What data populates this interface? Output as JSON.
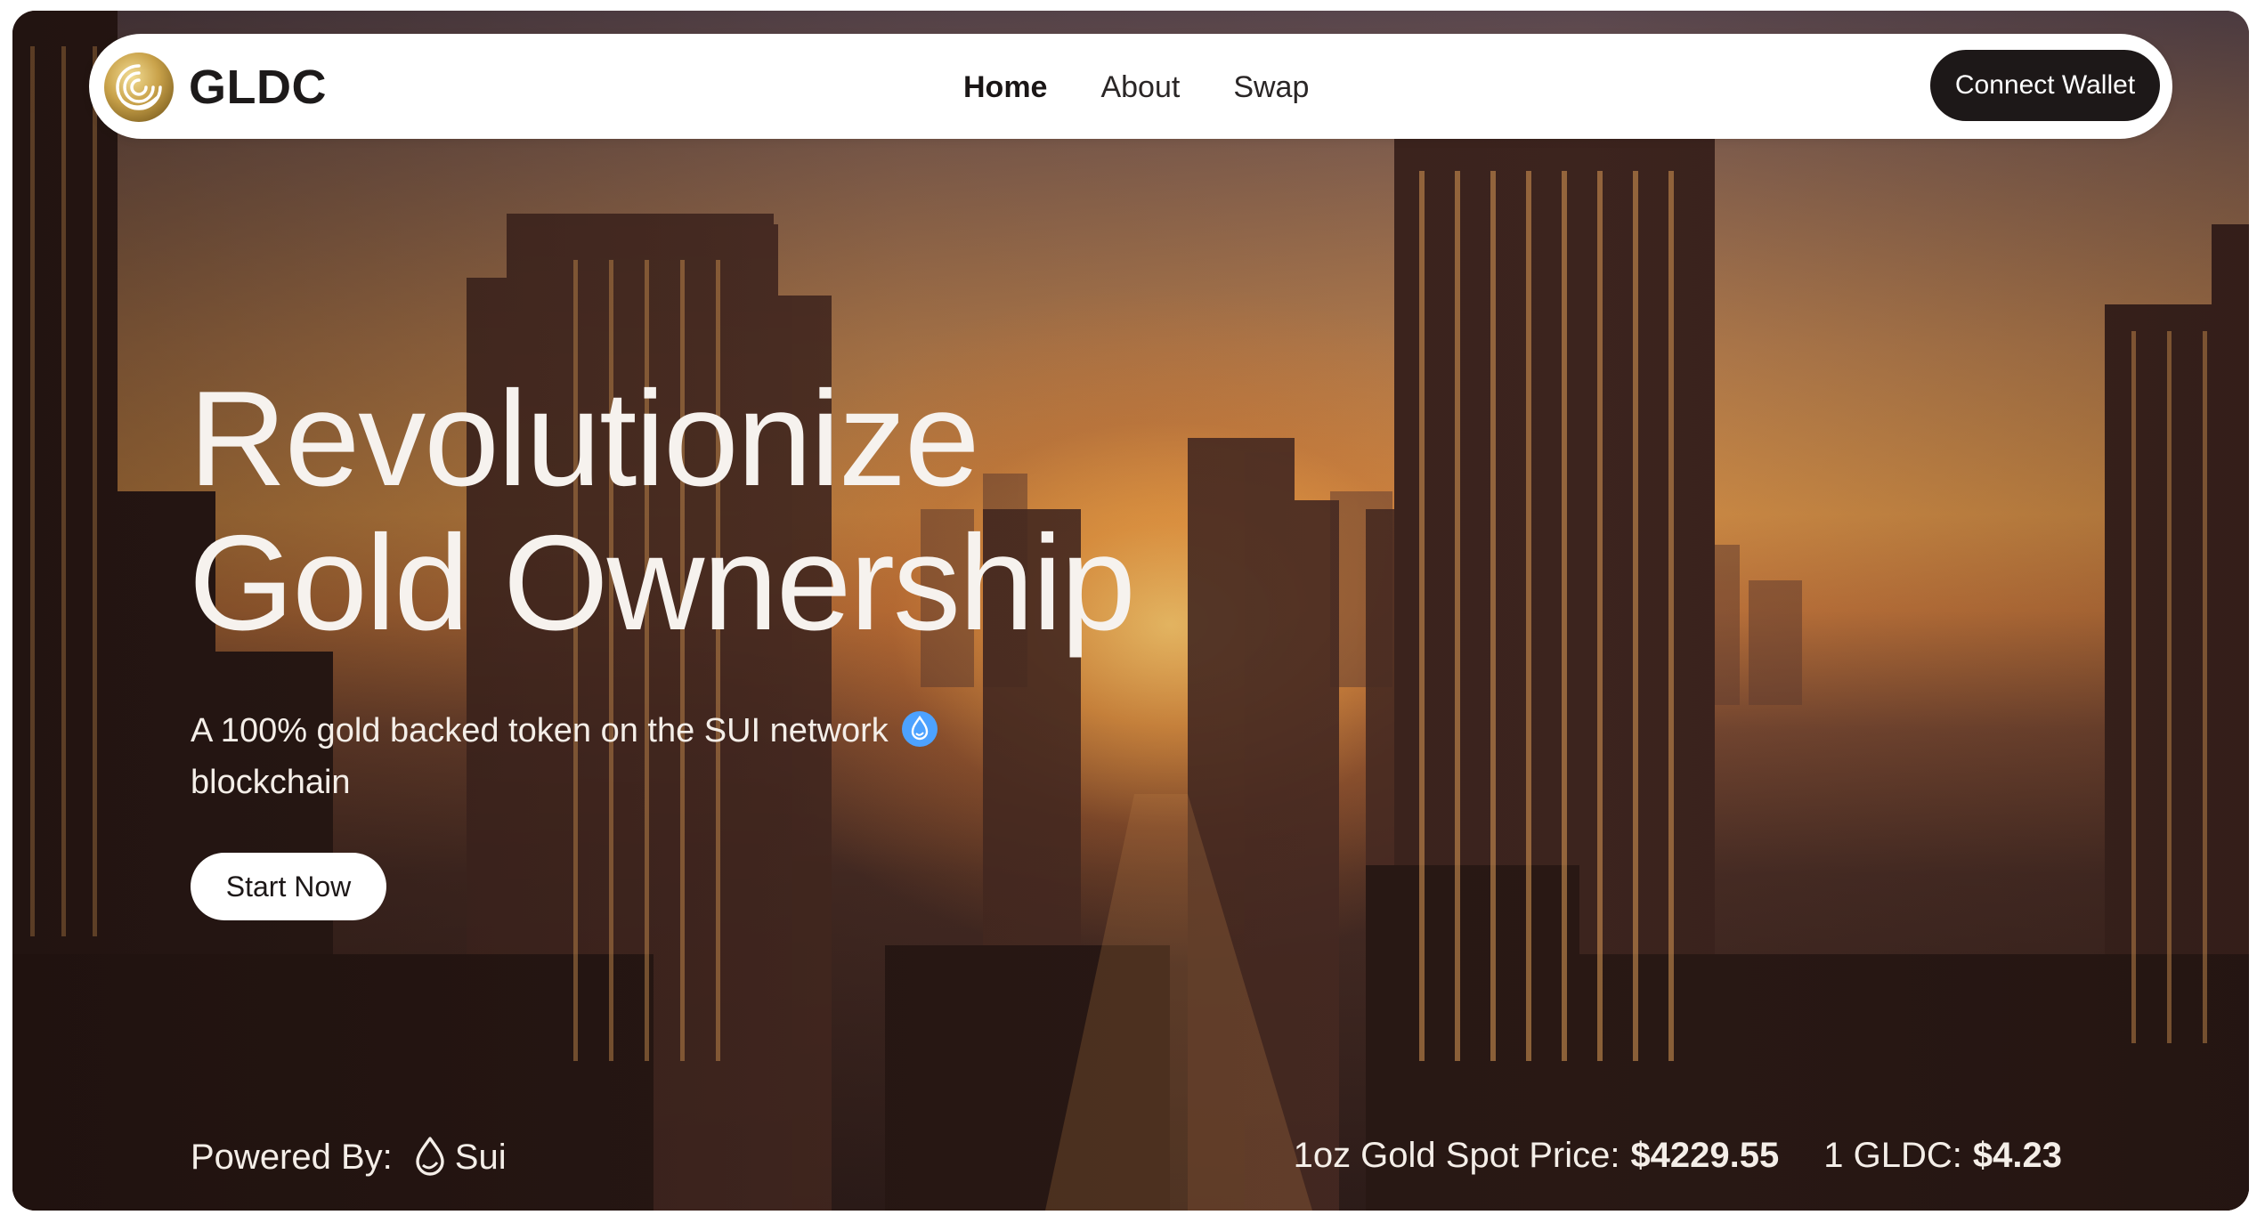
{
  "colors": {
    "nav_background": "#ffffff",
    "connect_button": "#1d1818",
    "accent_gold": "#c9a24a",
    "sui_blue": "#4da2ff",
    "hero_text": "#f6f2ee"
  },
  "header": {
    "logo_icon": "gldc-gold-coin-icon",
    "brand": "GLDC",
    "nav": [
      {
        "label": "Home",
        "active": true
      },
      {
        "label": "About",
        "active": false
      },
      {
        "label": "Swap",
        "active": false
      }
    ],
    "connect_label": "Connect Wallet"
  },
  "hero": {
    "headline_line1": "Revolutionize",
    "headline_line2": "Gold Ownership",
    "subtitle": "A 100% gold backed token on the SUI network",
    "subtitle_line2": "blockchain",
    "subtitle_icon": "sui-droplet-icon",
    "cta_label": "Start Now"
  },
  "footer": {
    "powered_label": "Powered By:",
    "powered_icon": "sui-logo-icon",
    "powered_name": "Sui",
    "spot_label": "1oz Gold Spot Price:",
    "spot_value": "$4229.55",
    "token_label": "1 GLDC:",
    "token_value": "$4.23"
  }
}
